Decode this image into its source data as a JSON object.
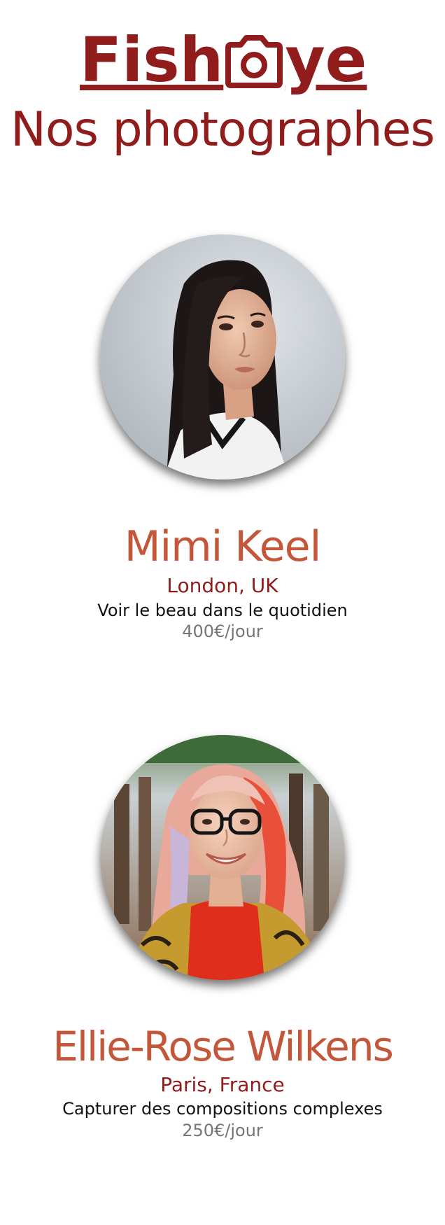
{
  "header": {
    "logo": {
      "part_before": "Fish",
      "icon": "camera-icon",
      "part_after": "ye",
      "color": "#901c1c"
    },
    "title": "Nos photographes"
  },
  "photographers": [
    {
      "name": "Mimi Keel",
      "location": "London, UK",
      "tagline": "Voir le beau dans le quotidien",
      "price": "400€/jour"
    },
    {
      "name": "Ellie-Rose Wilkens",
      "location": "Paris, France",
      "tagline": "Capturer des compositions complexes",
      "price": "250€/jour"
    }
  ],
  "colors": {
    "brand": "#901c1c",
    "name": "#c4563a",
    "price": "#757575",
    "text": "#111111"
  }
}
